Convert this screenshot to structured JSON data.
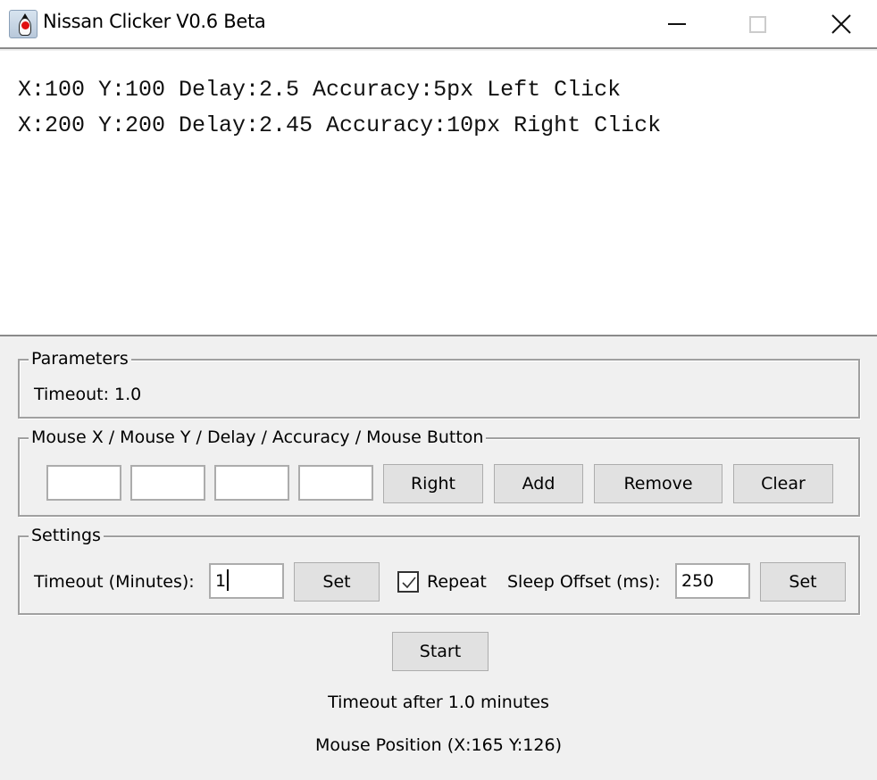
{
  "window": {
    "title": "Nissan Clicker V0.6 Beta",
    "icon": "java-duke-icon",
    "controls": [
      "minimize",
      "maximize",
      "close"
    ]
  },
  "log": {
    "lines": [
      "X:100 Y:100 Delay:2.5 Accuracy:5px Left Click",
      "X:200 Y:200 Delay:2.45 Accuracy:10px Right Click"
    ]
  },
  "parameters": {
    "title": "Parameters",
    "timeout_text": "Timeout: 1.0"
  },
  "mouse_group": {
    "title": "Mouse X / Mouse Y / Delay / Accuracy / Mouse Button",
    "fields": [
      {
        "name": "mouse-x",
        "value": ""
      },
      {
        "name": "mouse-y",
        "value": ""
      },
      {
        "name": "delay",
        "value": ""
      },
      {
        "name": "accuracy",
        "value": ""
      }
    ],
    "mouse_button_label": "Right",
    "add_label": "Add",
    "remove_label": "Remove",
    "clear_label": "Clear"
  },
  "settings": {
    "title": "Settings",
    "timeout_label": "Timeout (Minutes):",
    "timeout_value": "1",
    "timeout_set_label": "Set",
    "repeat_label": "Repeat",
    "repeat_checked": true,
    "sleep_offset_label": "Sleep Offset (ms):",
    "sleep_offset_value": "250",
    "sleep_set_label": "Set"
  },
  "start_label": "Start",
  "status": {
    "timeout_message": "Timeout after 1.0 minutes",
    "mouse_position": "Mouse Position (X:165 Y:126)"
  }
}
